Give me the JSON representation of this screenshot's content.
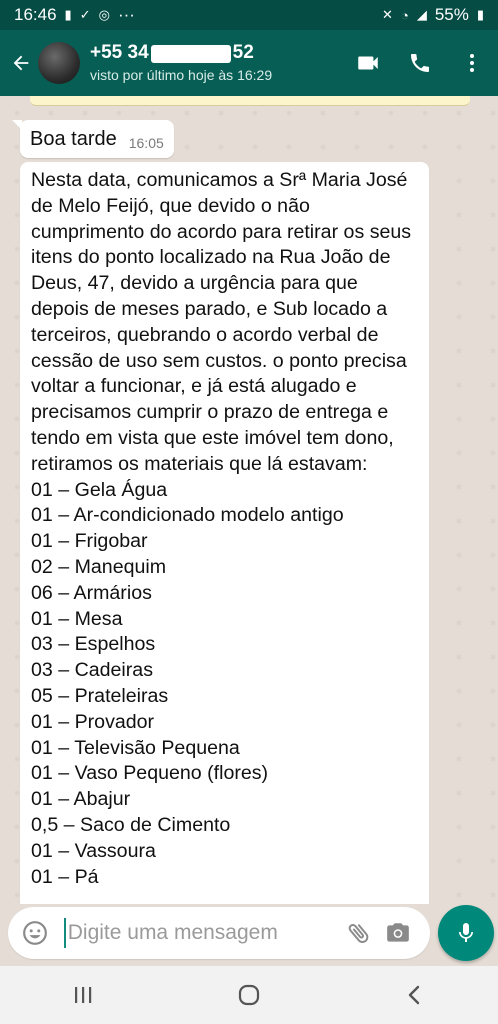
{
  "status_bar": {
    "time": "16:46",
    "more": "···",
    "battery": "55%"
  },
  "header": {
    "contact_prefix": "+55 34",
    "contact_suffix": "52",
    "last_seen": "visto por último hoje às 16:29"
  },
  "messages": [
    {
      "text": "Boa tarde",
      "time": "16:05"
    }
  ],
  "notice": {
    "paragraph": "Nesta data, comunicamos a Srª Maria José de Melo Feijó, que devido o não cumprimento do acordo para retirar os seus itens do ponto localizado na Rua João de Deus, 47,  devido a urgência para que depois de meses parado, e Sub locado a terceiros, quebrando o acordo verbal de cessão de uso sem custos. o ponto precisa voltar a funcionar, e já está alugado e precisamos cumprir o prazo de entrega e tendo em vista que este imóvel tem dono, retiramos os materiais que lá estavam:",
    "items": [
      "01 – Gela Água",
      "01 – Ar-condicionado modelo antigo",
      "01 – Frigobar",
      "02 – Manequim",
      "06 – Armários",
      "01 – Mesa",
      "03 – Espelhos",
      "03 – Cadeiras",
      "05 – Prateleiras",
      "01 – Provador",
      "01 – Televisão Pequena",
      "01 – Vaso Pequeno (flores)",
      "01 – Abajur",
      "0,5 – Saco de Cimento",
      "01 – Vassoura",
      "01 – Pá"
    ]
  },
  "input": {
    "placeholder": "Digite uma mensagem"
  },
  "colors": {
    "header": "#075e54",
    "status_bar": "#054d44",
    "chat_bg": "#e5ddd5",
    "mic_button": "#00897b"
  },
  "icons": [
    "back-arrow-icon",
    "video-call-icon",
    "phone-icon",
    "more-vert-icon",
    "emoji-icon",
    "attach-icon",
    "camera-icon",
    "mic-icon",
    "nav-recents-icon",
    "nav-home-icon",
    "nav-back-icon"
  ]
}
